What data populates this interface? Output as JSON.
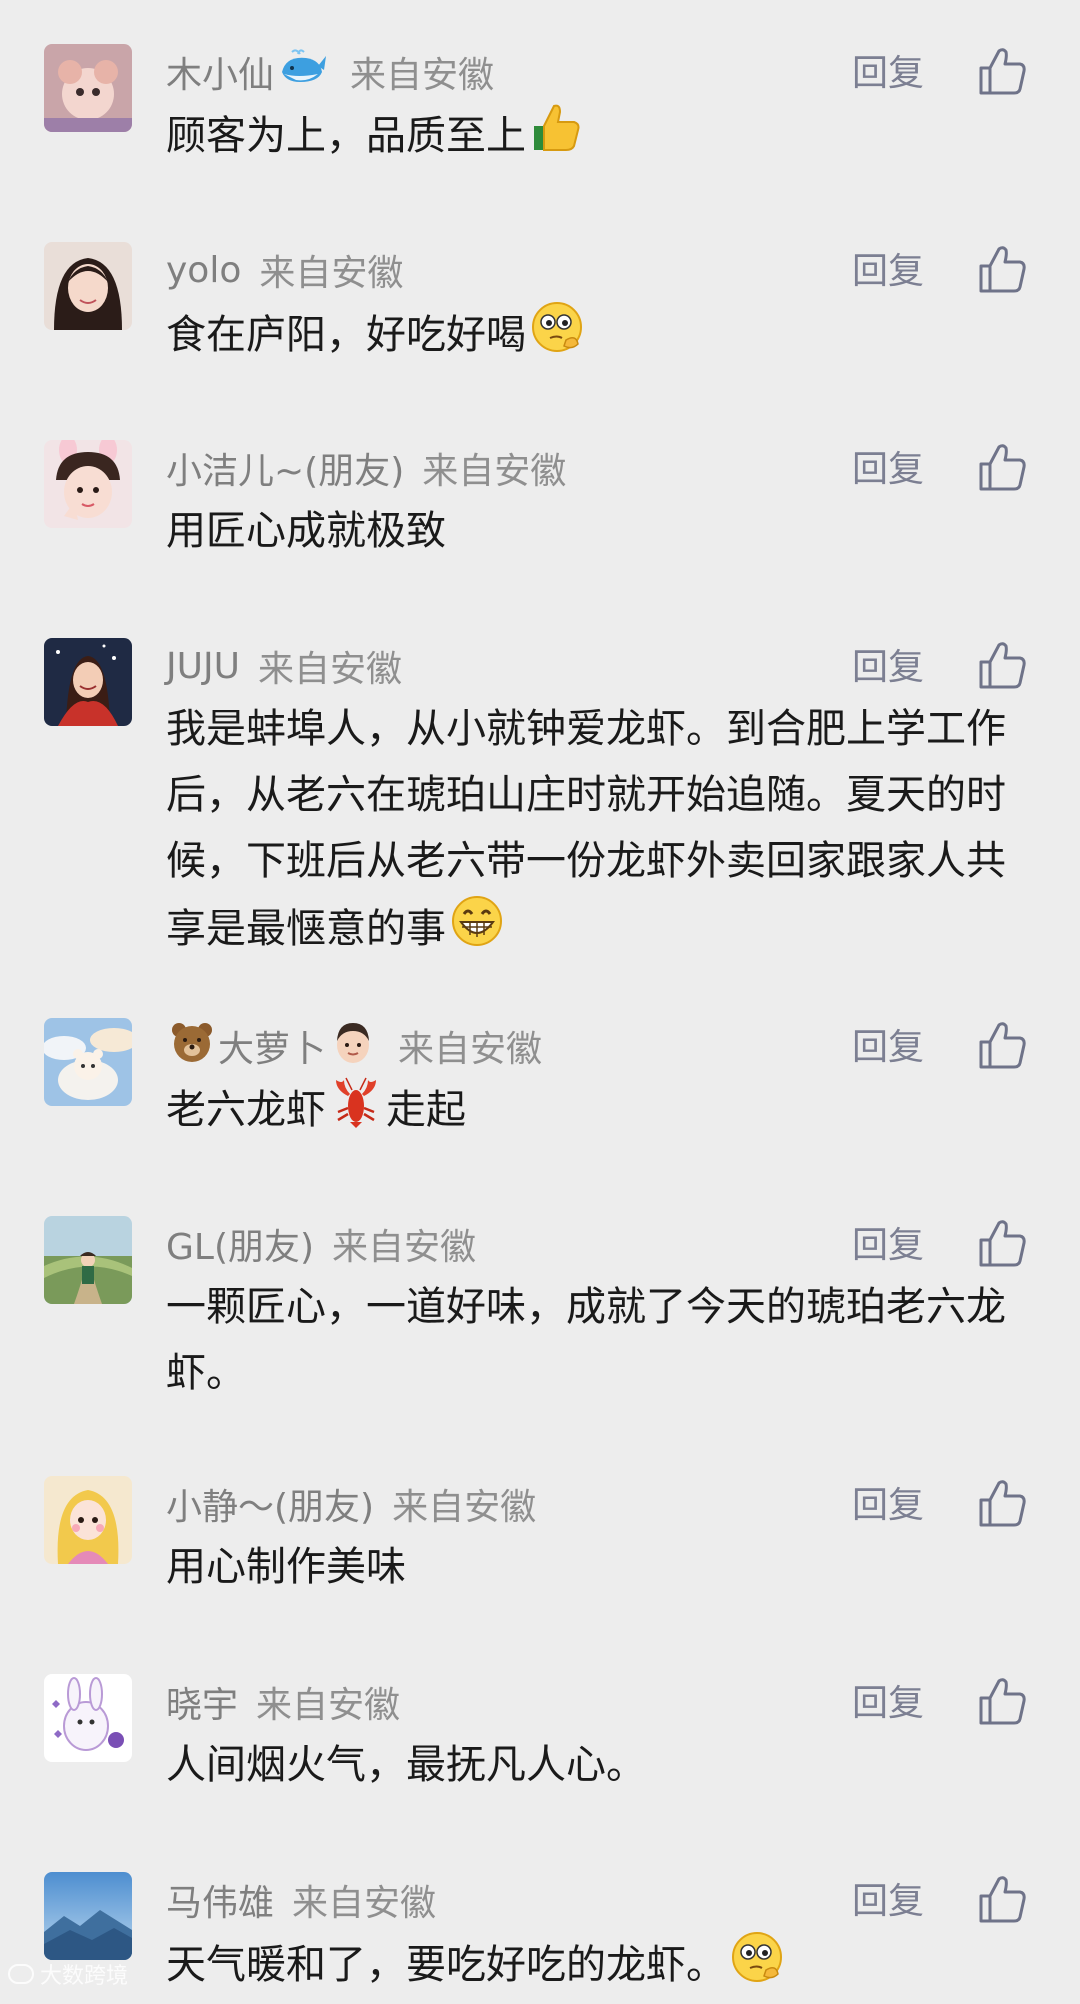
{
  "reply_label": "回复",
  "comments": [
    {
      "name": "木小仙",
      "location": "来自安徽",
      "text": "顾客为上，品质至上",
      "name_emoji": "whale-icon",
      "text_emoji": "thumbs-up-icon"
    },
    {
      "name": "yolo",
      "location": "来自安徽",
      "text": "食在庐阳，好吃好喝",
      "text_emoji": "smirk-face-icon"
    },
    {
      "name": "小洁儿~(朋友)",
      "location": "来自安徽",
      "text": "用匠心成就极致"
    },
    {
      "name": "JUJU",
      "location": "来自安徽",
      "text": "我是蚌埠人，从小就钟爱龙虾。到合肥上学工作后，从老六在琥珀山庄时就开始追随。夏天的时候，下班后从老六带一份龙虾外卖回家跟家人共享是最惬意的事",
      "text_emoji": "grin-face-icon"
    },
    {
      "name": "大萝卜",
      "location": "来自安徽",
      "text_before": "老六龙虾",
      "text_after": "走起",
      "name_emoji_before": "bear-icon",
      "name_emoji_after": "boy-face-icon",
      "text_emoji": "lobster-icon"
    },
    {
      "name": "GL(朋友)",
      "location": "来自安徽",
      "text": "一颗匠心，一道好味，成就了今天的琥珀老六龙虾。"
    },
    {
      "name": "小静～(朋友)",
      "location": "来自安徽",
      "text": "用心制作美味"
    },
    {
      "name": "晓宇",
      "location": "来自安徽",
      "text": "人间烟火气，最抚凡人心。"
    },
    {
      "name": "马伟雄",
      "location": "来自安徽",
      "text": "天气暖和了，要吃好吃的龙虾。",
      "text_emoji": "smirk-face-icon"
    }
  ],
  "watermark": "大数跨境",
  "colors": {
    "background": "#ededed",
    "name": "#7f7f7f",
    "text": "#1a1a1a",
    "reply": "#7c7f92"
  }
}
